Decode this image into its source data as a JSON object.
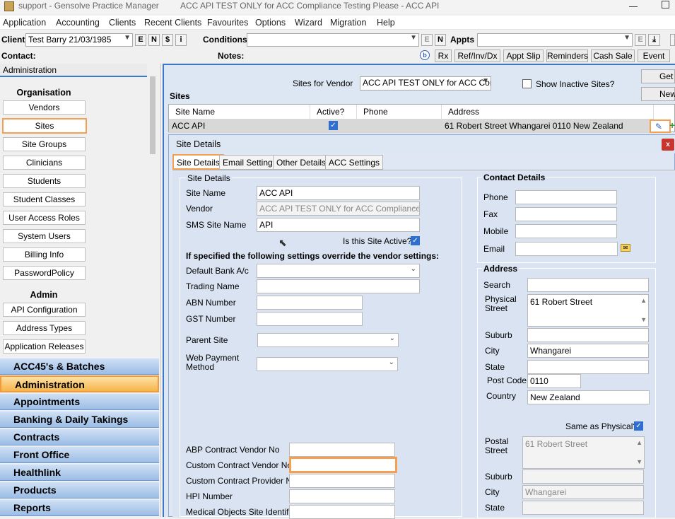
{
  "window": {
    "title_app": "support - Gensolve Practice Manager",
    "title_doc": "ACC API TEST ONLY for ACC Compliance Testing Please - ACC API"
  },
  "menu": [
    "Application",
    "Accounting",
    "Clients",
    "Recent Clients",
    "Favourites",
    "Options",
    "Wizard",
    "Migration",
    "Help"
  ],
  "toolbar": {
    "client_label": "Client",
    "client_value": "Test Barry 21/03/1985",
    "client_btns": [
      "E",
      "N",
      "$",
      "i"
    ],
    "conditions_label": "Conditions",
    "conditions_btns": [
      "E",
      "N"
    ],
    "appts_label": "Appts",
    "appts_btns": [
      "E"
    ],
    "contact_label": "Contact:",
    "notes_label": "Notes:",
    "buttons": [
      "Rx",
      "Ref/Inv/Dx",
      "Appt Slip",
      "Reminders",
      "Cash Sale",
      "Event"
    ]
  },
  "sidebar": {
    "header": "Administration",
    "organisation_title": "Organisation",
    "organisation_items": [
      "Vendors",
      "Sites",
      "Site Groups",
      "Clinicians",
      "Students",
      "Student Classes",
      "User Access Roles",
      "System Users",
      "Billing Info",
      "PasswordPolicy"
    ],
    "admin_title": "Admin",
    "admin_items": [
      "API Configuration",
      "Address Types",
      "Application Releases"
    ],
    "modules": [
      "ACC45's & Batches",
      "Administration",
      "Appointments",
      "Banking & Daily Takings",
      "Contracts",
      "Front Office",
      "Healthlink",
      "Products",
      "Reports"
    ]
  },
  "sites": {
    "vendor_label": "Sites for Vendor",
    "vendor_value": "ACC API TEST ONLY for ACC Cor",
    "show_inactive": "Show Inactive Sites?",
    "title": "Sites",
    "btn_get": "Get",
    "btn_new": "New",
    "columns": [
      "Site Name",
      "Active?",
      "Phone",
      "Address"
    ],
    "row": {
      "name": "ACC API",
      "phone": "",
      "address": "61 Robert Street Whangarei  0110 New Zealand"
    }
  },
  "dialog": {
    "title": "Site Details",
    "close": "x",
    "tabs": [
      "Site Details",
      "Email Settings",
      "Other Details",
      "ACC Settings"
    ],
    "group_site": "Site Details",
    "site_name_label": "Site Name",
    "site_name": "ACC API",
    "vendor_label": "Vendor",
    "vendor": "ACC API TEST ONLY for ACC Compliance T",
    "sms_label": "SMS Site Name",
    "sms": "API",
    "active_label": "Is this Site Active?",
    "override_note": "If specified the following settings override the vendor settings:",
    "bank_label": "Default Bank A/c",
    "trading_label": "Trading Name",
    "abn_label": "ABN Number",
    "gst_label": "GST Number",
    "parent_label": "Parent Site",
    "webpay_label": "Web Payment Method",
    "abp_label": "ABP Contract Vendor No",
    "custom_vendor_label": "Custom Contract Vendor No",
    "custom_provider_label": "Custom Contract Provider No",
    "hpi_label": "HPI Number",
    "medobj_label": "Medical Objects Site Identifier",
    "contact_title": "Contact Details",
    "phone_label": "Phone",
    "fax_label": "Fax",
    "mobile_label": "Mobile",
    "email_label": "Email",
    "address_title": "Address",
    "search_label": "Search",
    "physical_label": "Physical Street",
    "physical": "61 Robert Street",
    "suburb_label": "Suburb",
    "city_label": "City",
    "city": "Whangarei",
    "state_label": "State",
    "postcode_label": "Post Code",
    "postcode": "0110",
    "country_label": "Country",
    "country": "New Zealand",
    "same_label": "Same as Physical?",
    "postal_label": "Postal Street",
    "postal": "61 Robert Street",
    "postal_suburb_label": "Suburb",
    "postal_city_label": "City",
    "postal_city": "Whangarei",
    "postal_state_label": "State"
  }
}
